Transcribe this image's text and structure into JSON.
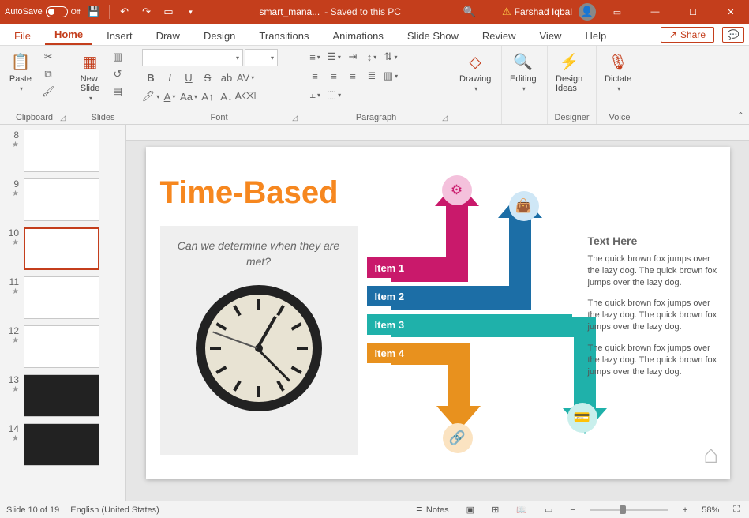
{
  "titlebar": {
    "autosave_label": "AutoSave",
    "autosave_state": "Off",
    "filename": "smart_mana...",
    "save_status": "- Saved to this PC",
    "user_name": "Farshad Iqbal"
  },
  "ribbon_tabs": {
    "file": "File",
    "home": "Home",
    "insert": "Insert",
    "draw": "Draw",
    "design": "Design",
    "transitions": "Transitions",
    "animations": "Animations",
    "slideshow": "Slide Show",
    "review": "Review",
    "view": "View",
    "help": "Help",
    "share": "Share"
  },
  "ribbon": {
    "clipboard": {
      "label": "Clipboard",
      "paste": "Paste"
    },
    "slides": {
      "label": "Slides",
      "newslide": "New\nSlide"
    },
    "font": {
      "label": "Font"
    },
    "paragraph": {
      "label": "Paragraph"
    },
    "drawing": {
      "label": "Drawing"
    },
    "editing": {
      "label": "Editing"
    },
    "designer": {
      "label": "Designer",
      "btn": "Design\nIdeas"
    },
    "voice": {
      "label": "Voice",
      "btn": "Dictate"
    }
  },
  "thumbnails": [
    {
      "num": "8"
    },
    {
      "num": "9"
    },
    {
      "num": "10",
      "selected": true
    },
    {
      "num": "11"
    },
    {
      "num": "12"
    },
    {
      "num": "13",
      "dark": true
    },
    {
      "num": "14",
      "dark": true
    }
  ],
  "slide": {
    "title": "Time-Based",
    "question": "Can we determine when they are met?",
    "items": [
      "Item 1",
      "Item 2",
      "Item 3",
      "Item 4"
    ],
    "text_heading": "Text Here",
    "para": "The quick brown fox jumps over the lazy dog. The quick brown fox jumps over the lazy dog."
  },
  "statusbar": {
    "slide_pos": "Slide 10 of 19",
    "language": "English (United States)",
    "notes": "Notes",
    "zoom": "58%"
  }
}
